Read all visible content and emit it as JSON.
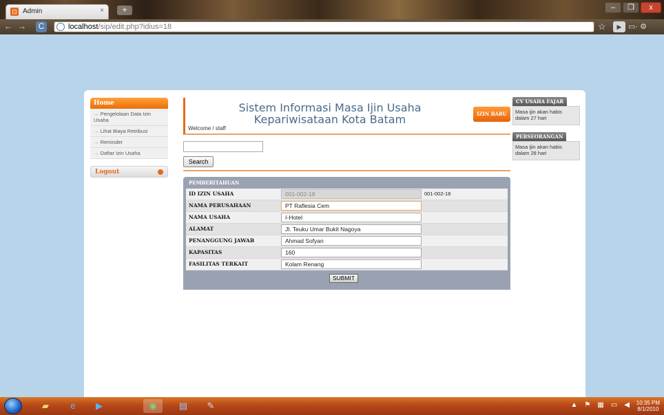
{
  "browser": {
    "tab_title": "Admin",
    "favicon": "⊡",
    "tab_close": "×",
    "new_tab": "+",
    "url_host": "localhost",
    "url_path": "/sip/edit.php?idius=18",
    "nav_back": "←",
    "nav_forward": "→",
    "nav_reload": "C",
    "star": "☆",
    "page_btn": "▶",
    "tools": "▭· ⚙",
    "win_min": "–",
    "win_max": "❐",
    "win_close": "x"
  },
  "sidebar": {
    "home": "Home",
    "items": [
      {
        "label": "Pengelolaan Data Izin Usaha"
      },
      {
        "label": "Lihat Biaya Retribusi"
      },
      {
        "label": "Reminder"
      },
      {
        "label": "Daftar Izin Usaha"
      }
    ],
    "logout": "Logout"
  },
  "header": {
    "title": "Sistem Informasi Masa Ijin Usaha Kepariwisataan Kota Batam",
    "welcome": "Welcome / staff",
    "new_permit": "IZIN BARU"
  },
  "search": {
    "value": "",
    "button": "Search"
  },
  "form": {
    "title": "PEMBERITAHUAN",
    "rows": [
      {
        "label": "ID IZIN USAHA",
        "value": "001-002-18",
        "extra": "001-002-18"
      },
      {
        "label": "NAMA PERUSAHAAN",
        "value": "PT Raflesia Cem"
      },
      {
        "label": "NAMA USAHA",
        "value": "I-Hotel"
      },
      {
        "label": "ALAMAT",
        "value": "Jl. Teuku Umar Bukit Nagoya"
      },
      {
        "label": "PENANGGUNG JAWAB",
        "value": "Ahmad Sofyan"
      },
      {
        "label": "KAPASITAS",
        "value": "160"
      },
      {
        "label": "FASILITAS TERKAIT",
        "value": "Kolam Renang"
      }
    ],
    "submit": "SUBMIT"
  },
  "notices": [
    {
      "title": "CV USAHA FAJAR",
      "body": "Masa ijin akan habis dalam 27 hari"
    },
    {
      "title": "PERSEORANGAN",
      "body": "Masa ijin akan habis dalam 28 hari"
    }
  ],
  "taskbar": {
    "time": "10:35 PM",
    "date": "8/1/2010",
    "icons": [
      "folder-icon",
      "ie-icon",
      "media-player-icon",
      "chrome-icon",
      "word-icon",
      "paint-icon"
    ]
  }
}
